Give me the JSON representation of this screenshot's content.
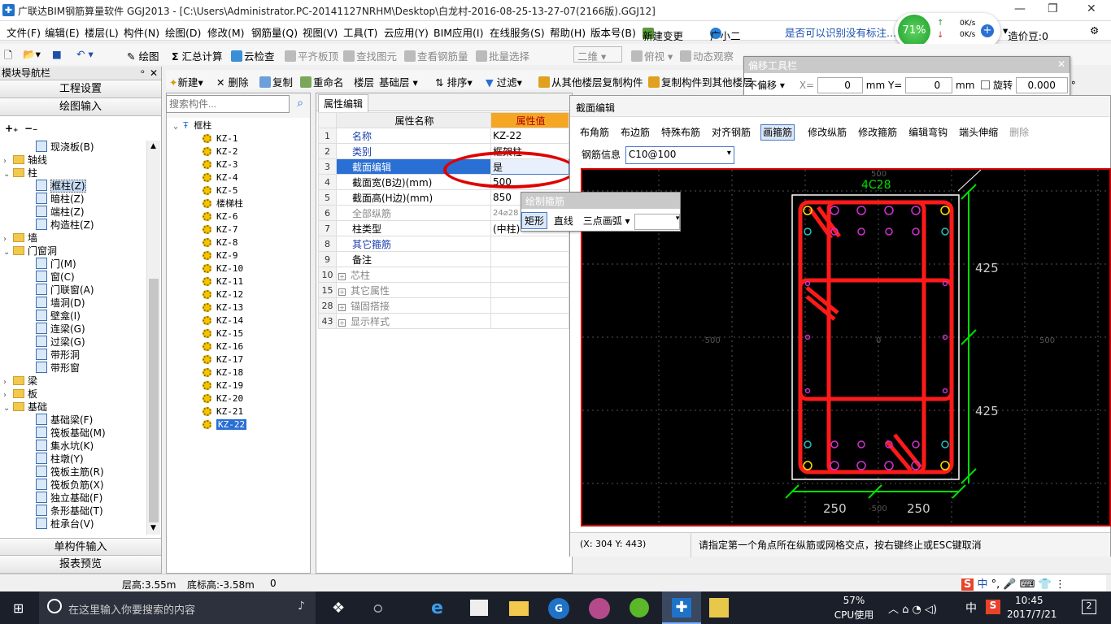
{
  "app": {
    "title": "广联达BIM钢筋算量软件 GGJ2013 - [C:\\Users\\Administrator.PC-20141127NRHM\\Desktop\\白龙村-2016-08-25-13-27-07(2166版).GGJ12]",
    "icon_glyph": "✚"
  },
  "menu": [
    "文件(F)",
    "编辑(E)",
    "楼层(L)",
    "构件(N)",
    "绘图(D)",
    "修改(M)",
    "钢筋量(Q)",
    "视图(V)",
    "工具(T)",
    "云应用(Y)",
    "BIM应用(I)",
    "在线服务(S)",
    "帮助(H)",
    "版本号(B)",
    "新建变更",
    "广小二"
  ],
  "menu_right": {
    "question": "是否可以识别没有标注...",
    "price": "造价豆:0"
  },
  "network": {
    "percent": "71%",
    "up": "0K/s",
    "down": "0K/s"
  },
  "toolbar1": [
    "绘图",
    "汇总计算",
    "云检查",
    "平齐板顶",
    "查找图元",
    "查看钢筋量",
    "批量选择",
    "二维",
    "俯视",
    "动态观察"
  ],
  "offset_toolbar": {
    "title": "偏移工具栏",
    "mode": "不偏移",
    "x_label": "X=",
    "x_value": "0",
    "y_label": "mm Y=",
    "y_value": "0",
    "unit": "mm",
    "rotate_label": "旋转",
    "rotate_value": "0.000",
    "deg": "°"
  },
  "left_panel": {
    "title": "模块导航栏",
    "btn_project": "工程设置",
    "btn_draw": "绘图输入",
    "btn_single": "单构件输入",
    "btn_report": "报表预览",
    "tree": [
      {
        "label": "现浇板(B)",
        "level": 2,
        "type": "item"
      },
      {
        "label": "轴线",
        "level": 1,
        "type": "folder",
        "exp": "+"
      },
      {
        "label": "柱",
        "level": 1,
        "type": "folder",
        "exp": "−"
      },
      {
        "label": "框柱(Z)",
        "level": 2,
        "type": "item",
        "selected": true
      },
      {
        "label": "暗柱(Z)",
        "level": 2,
        "type": "item"
      },
      {
        "label": "端柱(Z)",
        "level": 2,
        "type": "item"
      },
      {
        "label": "构造柱(Z)",
        "level": 2,
        "type": "item"
      },
      {
        "label": "墙",
        "level": 1,
        "type": "folder",
        "exp": "+"
      },
      {
        "label": "门窗洞",
        "level": 1,
        "type": "folder",
        "exp": "−"
      },
      {
        "label": "门(M)",
        "level": 2,
        "type": "item"
      },
      {
        "label": "窗(C)",
        "level": 2,
        "type": "item"
      },
      {
        "label": "门联窗(A)",
        "level": 2,
        "type": "item"
      },
      {
        "label": "墙洞(D)",
        "level": 2,
        "type": "item"
      },
      {
        "label": "壁龛(I)",
        "level": 2,
        "type": "item"
      },
      {
        "label": "连梁(G)",
        "level": 2,
        "type": "item"
      },
      {
        "label": "过梁(G)",
        "level": 2,
        "type": "item"
      },
      {
        "label": "带形洞",
        "level": 2,
        "type": "item"
      },
      {
        "label": "带形窗",
        "level": 2,
        "type": "item"
      },
      {
        "label": "梁",
        "level": 1,
        "type": "folder",
        "exp": "+"
      },
      {
        "label": "板",
        "level": 1,
        "type": "folder",
        "exp": "+"
      },
      {
        "label": "基础",
        "level": 1,
        "type": "folder",
        "exp": "−"
      },
      {
        "label": "基础梁(F)",
        "level": 2,
        "type": "item"
      },
      {
        "label": "筏板基础(M)",
        "level": 2,
        "type": "item"
      },
      {
        "label": "集水坑(K)",
        "level": 2,
        "type": "item"
      },
      {
        "label": "柱墩(Y)",
        "level": 2,
        "type": "item"
      },
      {
        "label": "筏板主筋(R)",
        "level": 2,
        "type": "item"
      },
      {
        "label": "筏板负筋(X)",
        "level": 2,
        "type": "item"
      },
      {
        "label": "独立基础(F)",
        "level": 2,
        "type": "item"
      },
      {
        "label": "条形基础(T)",
        "level": 2,
        "type": "item"
      },
      {
        "label": "桩承台(V)",
        "level": 2,
        "type": "item"
      }
    ]
  },
  "component_toolbar": [
    "新建",
    "删除",
    "复制",
    "重命名",
    "楼层",
    "基础层",
    "排序",
    "过滤",
    "从其他楼层复制构件",
    "复制构件到其他楼层"
  ],
  "component_list": {
    "search_placeholder": "搜索构件...",
    "root": "框柱",
    "items": [
      "KZ-1",
      "KZ-2",
      "KZ-3",
      "KZ-4",
      "KZ-5",
      "楼梯柱",
      "KZ-6",
      "KZ-7",
      "KZ-8",
      "KZ-9",
      "KZ-10",
      "KZ-11",
      "KZ-12",
      "KZ-13",
      "KZ-14",
      "KZ-15",
      "KZ-16",
      "KZ-17",
      "KZ-18",
      "KZ-19",
      "KZ-20",
      "KZ-21",
      "KZ-22"
    ],
    "selected": "KZ-22"
  },
  "properties": {
    "tab": "属性编辑",
    "col_name": "属性名称",
    "col_value": "属性值",
    "rows": [
      {
        "n": "1",
        "name": "名称",
        "value": "KZ-22",
        "style": "blue"
      },
      {
        "n": "2",
        "name": "类别",
        "value": "框架柱",
        "style": "blue"
      },
      {
        "n": "3",
        "name": "截面编辑",
        "value": "是",
        "style": "sel"
      },
      {
        "n": "4",
        "name": "截面宽(B边)(mm)",
        "value": "500",
        "style": ""
      },
      {
        "n": "5",
        "name": "截面高(H边)(mm)",
        "value": "850",
        "style": ""
      },
      {
        "n": "6",
        "name": "全部纵筋",
        "value": "24⌀28",
        "style": "gray"
      },
      {
        "n": "7",
        "name": "柱类型",
        "value": "(中柱)",
        "style": ""
      },
      {
        "n": "8",
        "name": "其它箍筋",
        "value": "",
        "style": "blue"
      },
      {
        "n": "9",
        "name": "备注",
        "value": "",
        "style": ""
      },
      {
        "n": "10",
        "name": "芯柱",
        "value": "",
        "style": "gray",
        "exp": "+"
      },
      {
        "n": "15",
        "name": "其它属性",
        "value": "",
        "style": "gray",
        "exp": "+"
      },
      {
        "n": "28",
        "name": "锚固搭接",
        "value": "",
        "style": "gray",
        "exp": "+"
      },
      {
        "n": "43",
        "name": "显示样式",
        "value": "",
        "style": "gray",
        "exp": "+"
      }
    ]
  },
  "draw_stirrup": {
    "title": "绘制箍筋",
    "rect": "矩形",
    "line": "直线",
    "arc": "三点画弧"
  },
  "section_editor": {
    "title": "截面编辑",
    "tools": [
      "布角筋",
      "布边筋",
      "特殊布筋",
      "对齐钢筋",
      "画箍筋",
      "修改纵筋",
      "修改箍筋",
      "编辑弯钩",
      "端头伸缩",
      "删除"
    ],
    "active_tool": "画箍筋",
    "info_label": "钢筋信息",
    "info_value": "C10@100",
    "top_label": "4C28",
    "dim_right_1": "425",
    "dim_right_2": "425",
    "dim_bottom_1": "250",
    "dim_bottom_2": "250",
    "axis_left": "-500",
    "axis_right": "500",
    "axis_top": "500",
    "axis_bottom": "-500",
    "axis_center": "0",
    "coords": "(X: 304 Y: 443)",
    "hint": "请指定第一个角点所在纵筋或网格交点，按右键终止或ESC键取消"
  },
  "status": {
    "floor_height": "层高:3.55m",
    "bottom_height": "底标高:-3.58m",
    "zero": "0"
  },
  "taskbar": {
    "search": "在这里输入你要搜索的内容",
    "cpu_pct": "57%",
    "cpu_label": "CPU使用",
    "ime": "中",
    "time": "10:45",
    "date": "2017/7/21",
    "badge": "2"
  },
  "colors": {
    "rebar": "#ff1a1a",
    "canvas_bg": "#000000",
    "dim": "#00dd00",
    "accent": "#1e73c8"
  }
}
